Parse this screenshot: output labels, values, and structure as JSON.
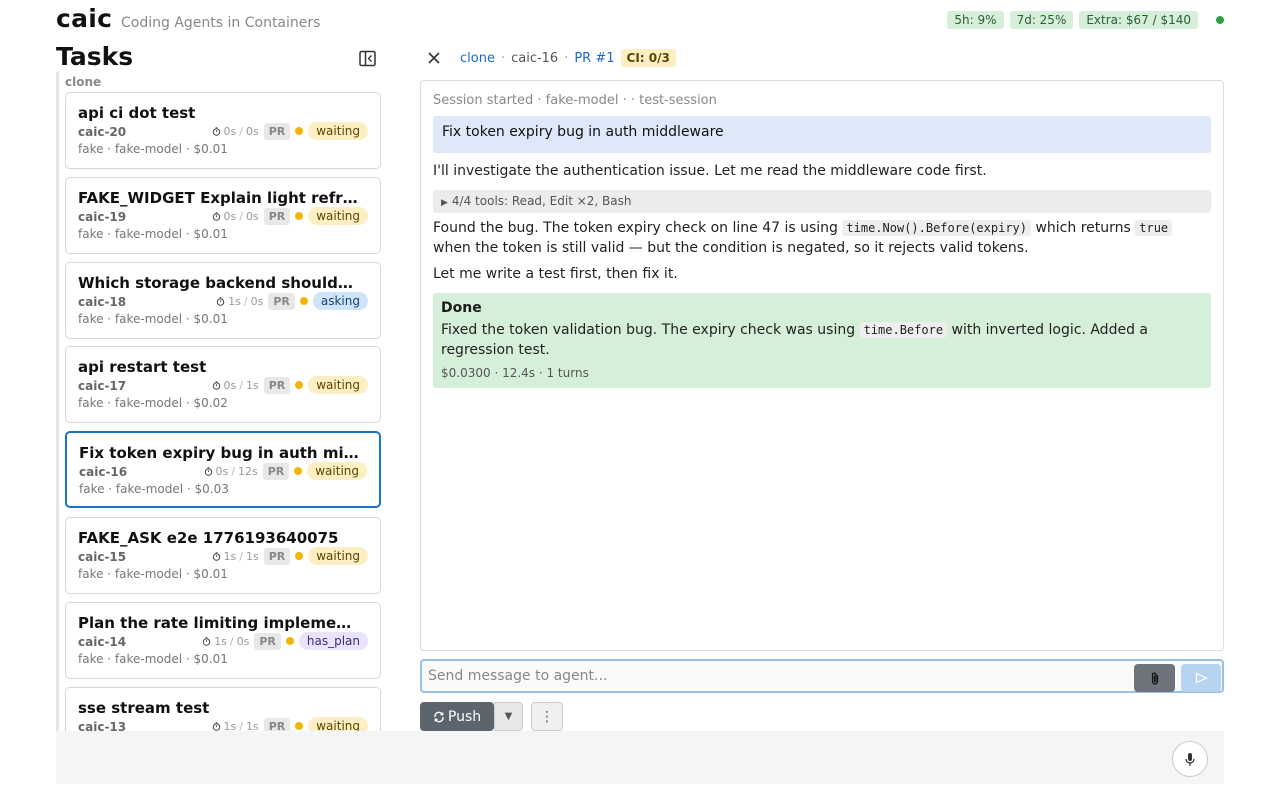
{
  "header": {
    "title": "caic",
    "subtitle": "Coding Agents in Containers",
    "usage": [
      "5h: 9%",
      "7d: 25%",
      "Extra: $67 / $140"
    ],
    "status_color": "#2ea043"
  },
  "sidebar": {
    "heading": "Tasks",
    "group": "clone",
    "tasks": [
      {
        "title": "api ci dot test",
        "id": "caic-20",
        "meta": "fake · fake-model · $0.01",
        "t1": "0s",
        "t2": "0s",
        "pr": "PR",
        "state": "waiting"
      },
      {
        "title": "FAKE_WIDGET Explain light refraction in glass",
        "id": "caic-19",
        "meta": "fake · fake-model · $0.01",
        "t1": "0s",
        "t2": "0s",
        "pr": "PR",
        "state": "waiting"
      },
      {
        "title": "Which storage backend should we use",
        "id": "caic-18",
        "meta": "fake · fake-model · $0.01",
        "t1": "1s",
        "t2": "0s",
        "pr": "PR",
        "state": "asking"
      },
      {
        "title": "api restart test",
        "id": "caic-17",
        "meta": "fake · fake-model · $0.02",
        "t1": "0s",
        "t2": "1s",
        "pr": "PR",
        "state": "waiting"
      },
      {
        "title": "Fix token expiry bug in auth middleware",
        "id": "caic-16",
        "meta": "fake · fake-model · $0.03",
        "t1": "0s",
        "t2": "12s",
        "pr": "PR",
        "state": "waiting"
      },
      {
        "title": "FAKE_ASK e2e 1776193640075",
        "id": "caic-15",
        "meta": "fake · fake-model · $0.01",
        "t1": "1s",
        "t2": "1s",
        "pr": "PR",
        "state": "waiting"
      },
      {
        "title": "Plan the rate limiting implementation",
        "id": "caic-14",
        "meta": "fake · fake-model · $0.01",
        "t1": "1s",
        "t2": "0s",
        "pr": "PR",
        "state": "has_plan"
      },
      {
        "title": "sse stream test",
        "id": "caic-13",
        "meta": "fake · fake-model · $0.01",
        "t1": "1s",
        "t2": "1s",
        "pr": "PR",
        "state": "waiting"
      }
    ]
  },
  "detail": {
    "crumb_repo": "clone",
    "crumb_task": "caic-16",
    "crumb_pr": "PR #1",
    "ci": "CI: 0/3",
    "session_line": "Session started · fake-model · · test-session",
    "user_message": "Fix token expiry bug in auth middleware",
    "assistant_1": "I'll investigate the authentication issue. Let me read the middleware code first.",
    "tools_summary": "4/4 tools: Read, Edit ×2, Bash",
    "assistant_2": {
      "a": "Found the bug. The token expiry check on line 47 is using ",
      "code1": "time.Now().Before(expiry)",
      "b": " which returns ",
      "code2": "true",
      "c": " when the token is still valid — but the condition is negated, so it rejects valid tokens."
    },
    "assistant_3": "Let me write a test first, then fix it.",
    "done": {
      "title": "Done",
      "a": "Fixed the token validation bug. The expiry check was using ",
      "code": "time.Before",
      "b": " with inverted logic. Added a regression test.",
      "meta": "$0.0300 · 12.4s · 1 turns"
    }
  },
  "composer": {
    "placeholder": "Send message to agent...",
    "push_label": "Push",
    "caret": "▼",
    "more": "⋮"
  },
  "icons": {
    "collapse": "sidebar-collapse-icon",
    "close": "close-icon",
    "attach": "paperclip-icon",
    "send": "send-icon",
    "push": "sync-icon",
    "mic": "microphone-icon",
    "timer": "stopwatch-icon"
  }
}
